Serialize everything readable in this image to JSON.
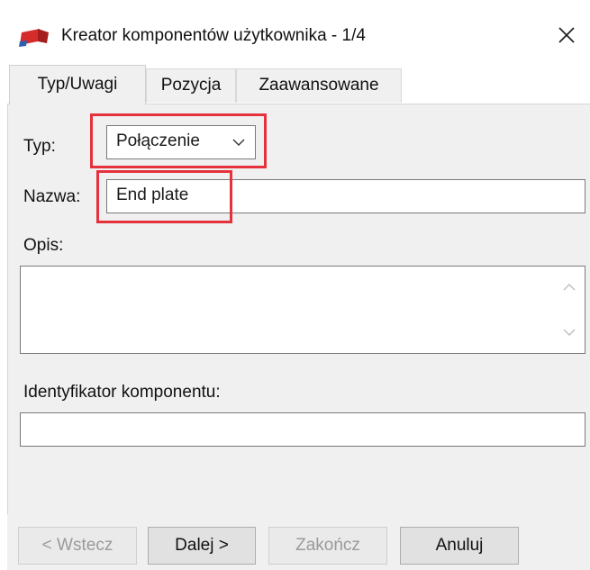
{
  "window": {
    "title": "Kreator komponentów użytkownika - 1/4",
    "icon": "app-logo-icon",
    "close_icon": "close-icon"
  },
  "tabs": [
    {
      "label": "Typ/Uwagi",
      "active": true
    },
    {
      "label": "Pozycja",
      "active": false
    },
    {
      "label": "Zaawansowane",
      "active": false
    }
  ],
  "form": {
    "type_label": "Typ:",
    "type_value": "Połączenie",
    "name_label": "Nazwa:",
    "name_value": "End plate",
    "description_label": "Opis:",
    "description_value": "",
    "identifier_label": "Identyfikator komponentu:",
    "identifier_value": ""
  },
  "buttons": {
    "back": "< Wstecz",
    "next": "Dalej >",
    "finish": "Zakończ",
    "cancel": "Anuluj"
  },
  "colors": {
    "highlight": "#e4313b",
    "panel": "#f0f0f0"
  }
}
